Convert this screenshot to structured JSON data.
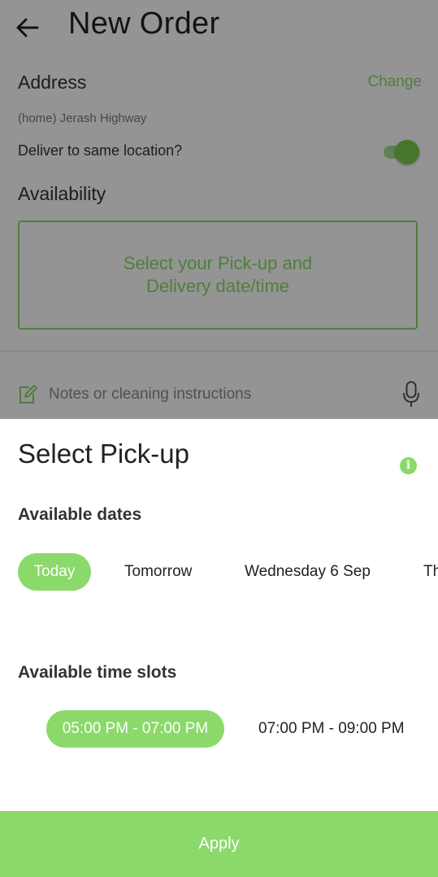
{
  "header": {
    "title": "New Order",
    "back_icon": "arrow-left-icon"
  },
  "address": {
    "label": "Address",
    "change_label": "Change",
    "value": "(home) Jerash Highway",
    "same_location_label": "Deliver to same location?",
    "same_location_on": true
  },
  "availability": {
    "label": "Availability",
    "line1": "Select your Pick-up and",
    "line2": "Delivery date/time"
  },
  "notes": {
    "placeholder": "Notes or cleaning instructions",
    "icon": "edit-note-icon",
    "mic_icon": "microphone-icon"
  },
  "sheet": {
    "title": "Select Pick-up",
    "info_icon": "info-icon",
    "dates_label": "Available dates",
    "dates": [
      {
        "label": "Today",
        "selected": true
      },
      {
        "label": "Tomorrow",
        "selected": false
      },
      {
        "label": "Wednesday  6 Sep",
        "selected": false
      },
      {
        "label": "Th",
        "selected": false
      }
    ],
    "slots_label": "Available time slots",
    "slots": [
      {
        "label": "05:00 PM - 07:00 PM",
        "selected": true
      },
      {
        "label": "07:00 PM - 09:00 PM",
        "selected": false
      }
    ],
    "apply_label": "Apply"
  },
  "colors": {
    "accent": "#8BD96A",
    "overlay": "rgba(0,0,0,0.42)"
  }
}
